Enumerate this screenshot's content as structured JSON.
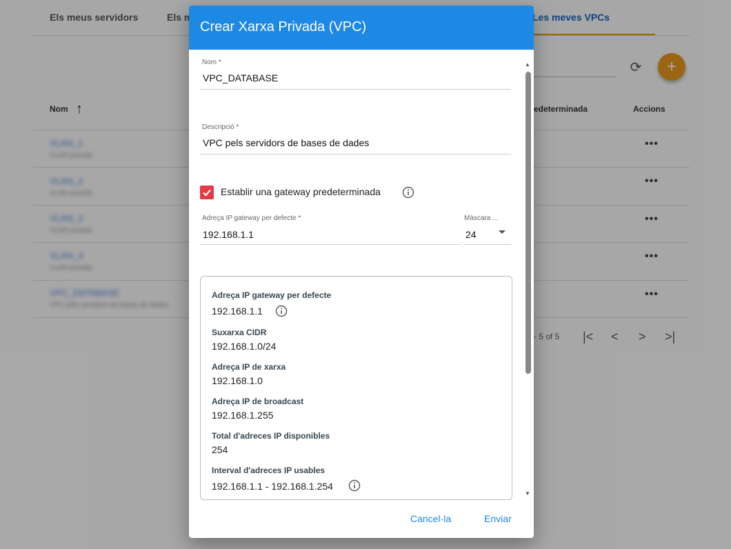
{
  "background": {
    "tabs": [
      "Els meus servidors",
      "Els m",
      "Les meves VPCs"
    ],
    "columns": {
      "name": "Nom",
      "default": "edeterminada",
      "actions": "Accions"
    },
    "rows": [
      {
        "name": "VLAN_1",
        "sub": "VLAN privada"
      },
      {
        "name": "VLAN_2",
        "sub": "VLAN privada"
      },
      {
        "name": "VLAN_3",
        "sub": "VLAN privada"
      },
      {
        "name": "VLAN_4",
        "sub": "VLAN privada"
      },
      {
        "name": "VPC_DATABASE",
        "sub": "VPC pels servidors de bases de dades"
      }
    ],
    "row_actions": "•••",
    "pager": "- 5 of 5"
  },
  "dialog": {
    "title": "Crear Xarxa Privada (VPC)",
    "name": {
      "label": "Nom *",
      "value": "VPC_DATABASE"
    },
    "description": {
      "label": "Descripció *",
      "value": "VPC pels servidors de bases de dades"
    },
    "gateway_checkbox": {
      "label": "Establir una gateway predeterminada",
      "checked": true
    },
    "gateway_ip": {
      "label": "Adreça IP gateway per defecte *",
      "value": "192.168.1.1"
    },
    "mask": {
      "label": "Màscara ...",
      "value": "24"
    },
    "info": [
      {
        "label": "Adreça IP gateway per defecte",
        "value": "192.168.1.1"
      },
      {
        "label": "Suxarxa CIDR",
        "value": "192.168.1.0/24"
      },
      {
        "label": "Adreça IP de xarxa",
        "value": "192.168.1.0"
      },
      {
        "label": "Adreça IP de broadcast",
        "value": "192.168.1.255"
      },
      {
        "label": "Total d'adreces IP disponibles",
        "value": "254"
      },
      {
        "label": "Interval d'adreces IP usables",
        "value": "192.168.1.1 - 192.168.1.254"
      }
    ],
    "cancel": "Cancel·la",
    "submit": "Enviar"
  },
  "colors": {
    "header": "#1e88e5",
    "accent": "#e6991d",
    "checkbox": "#e53946"
  }
}
